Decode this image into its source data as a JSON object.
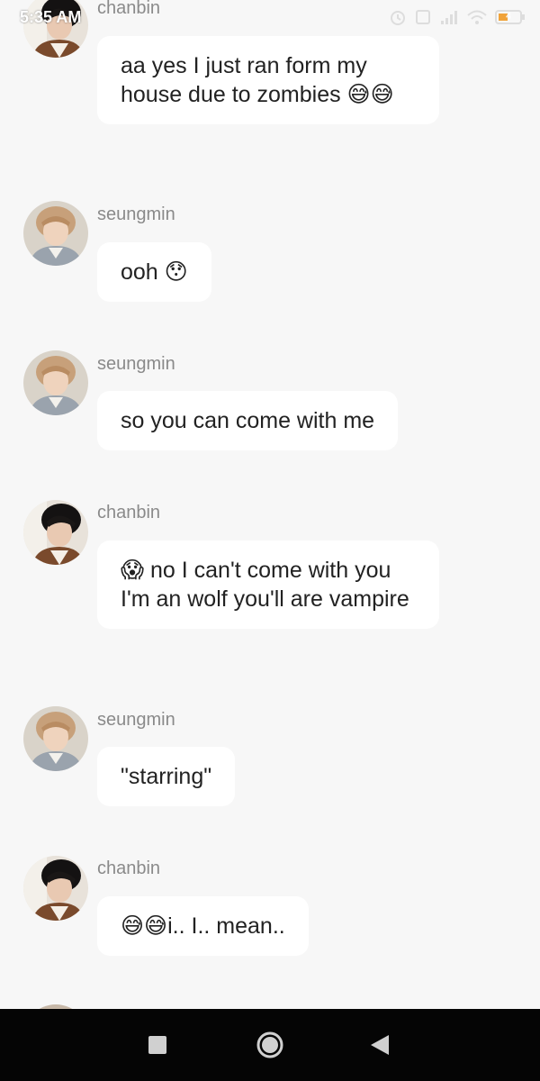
{
  "status_bar": {
    "time": "5:35 AM",
    "battery_level": "4",
    "icons": [
      "alarm-icon",
      "screen-icon",
      "signal-icon",
      "wifi-icon",
      "battery-icon"
    ]
  },
  "colors": {
    "background": "#f7f7f7",
    "bubble": "#ffffff",
    "sender_text": "#8a8a8a",
    "message_text": "#222222",
    "nav_bar": "#050505"
  },
  "messages": [
    {
      "sender": "chanbin",
      "text": "aa yes I just ran form my house due to zombies 😅😅"
    },
    {
      "sender": "seungmin",
      "text": "ooh 😯"
    },
    {
      "sender": "seungmin",
      "text": "so you can come with me"
    },
    {
      "sender": "chanbin",
      "text": "😱 no I can't come with you I'm an wolf you'll are vampire"
    },
    {
      "sender": "seungmin",
      "text": "\"starring\""
    },
    {
      "sender": "chanbin",
      "text": "😅😅i.. I.. mean.."
    }
  ],
  "nav_bar": {
    "buttons": [
      "recents-square-icon",
      "home-circle-icon",
      "back-triangle-icon"
    ]
  }
}
